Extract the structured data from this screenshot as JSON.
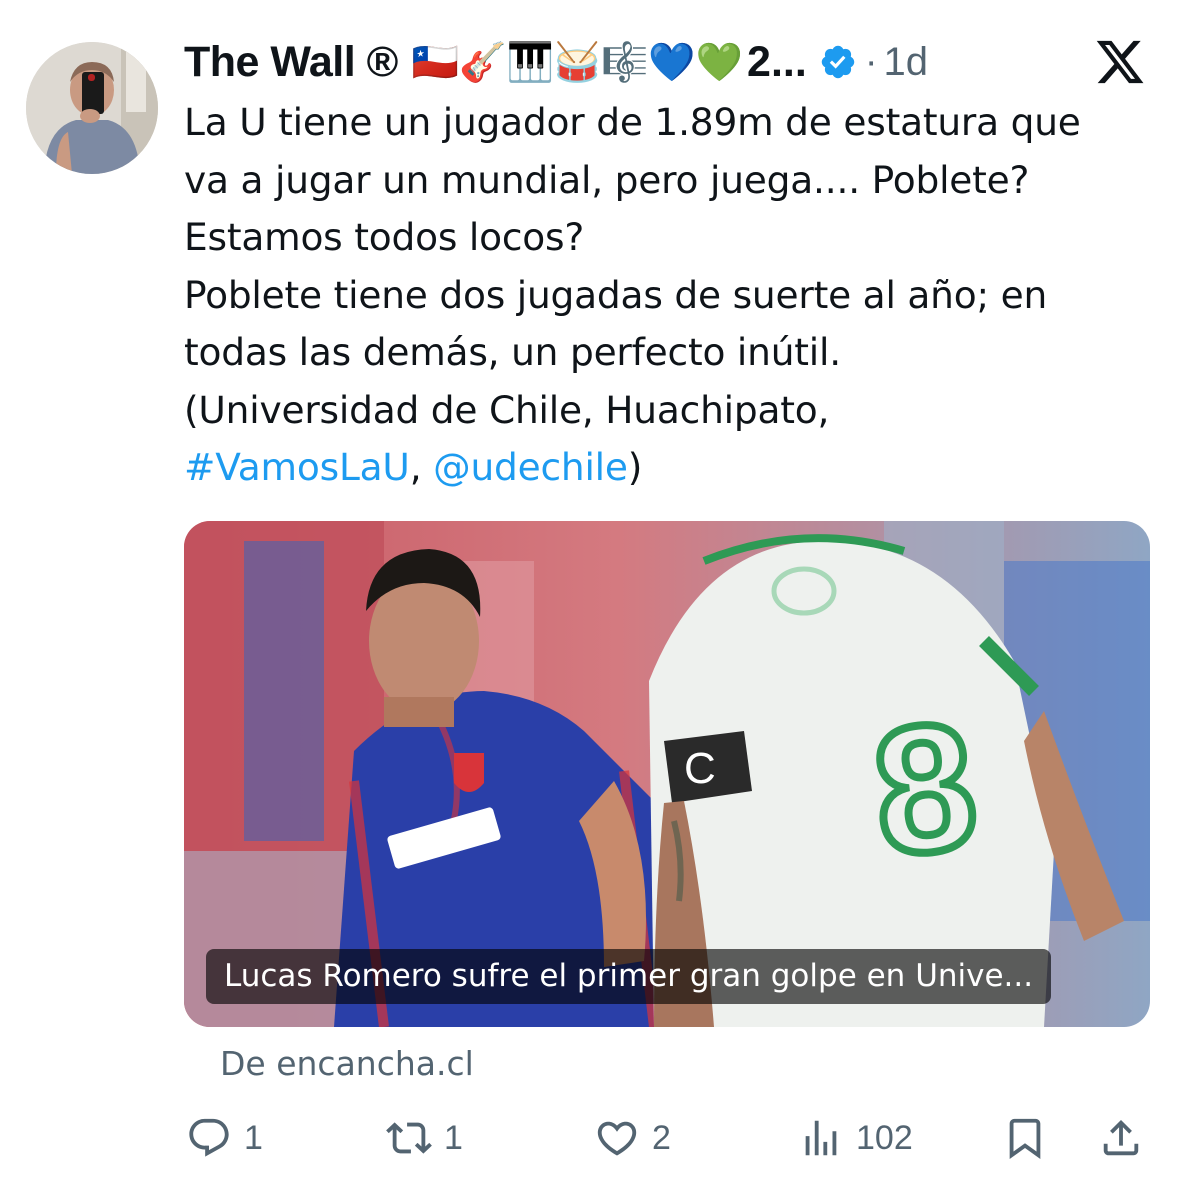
{
  "author": {
    "display_name": "The Wall",
    "registered_mark": "®",
    "emoji_suffix": "🇨🇱🎸🎹🥁🎼💙💚",
    "name_truncation": "2...",
    "separator": "·",
    "timestamp": "1d"
  },
  "icons": {
    "avatar": "avatar-photo",
    "verified": "verified-badge-icon",
    "platform": "x-logo-icon",
    "reply": "reply-icon",
    "repost": "repost-icon",
    "like": "heart-icon",
    "views": "views-bar-chart-icon",
    "bookmark": "bookmark-icon",
    "share": "share-icon"
  },
  "tweet": {
    "line1": "La U tiene un jugador de 1.89m de estatura que",
    "line2": "va a jugar un mundial, pero juega.... Poblete?",
    "line3": "Estamos todos locos?",
    "line4": "Poblete tiene dos jugadas de suerte al año; en",
    "line5": "todas las demás, un perfecto inútil.",
    "line6": "(Universidad de Chile, Huachipato,",
    "hashtag": "#VamosLaU",
    "comma": ", ",
    "mention": "@udechile",
    "close_paren": ")"
  },
  "card": {
    "caption": "Lucas Romero sufre el primer gran golpe en Unive...",
    "source": "De encancha.cl",
    "image_description_icon": "football-match-photo"
  },
  "engagement": {
    "replies": "1",
    "reposts": "1",
    "likes": "2",
    "views": "102"
  },
  "colors": {
    "link": "#1d9bf0",
    "secondary_text": "#536471",
    "verified": "#1d9bf0",
    "text": "#0f1419"
  }
}
